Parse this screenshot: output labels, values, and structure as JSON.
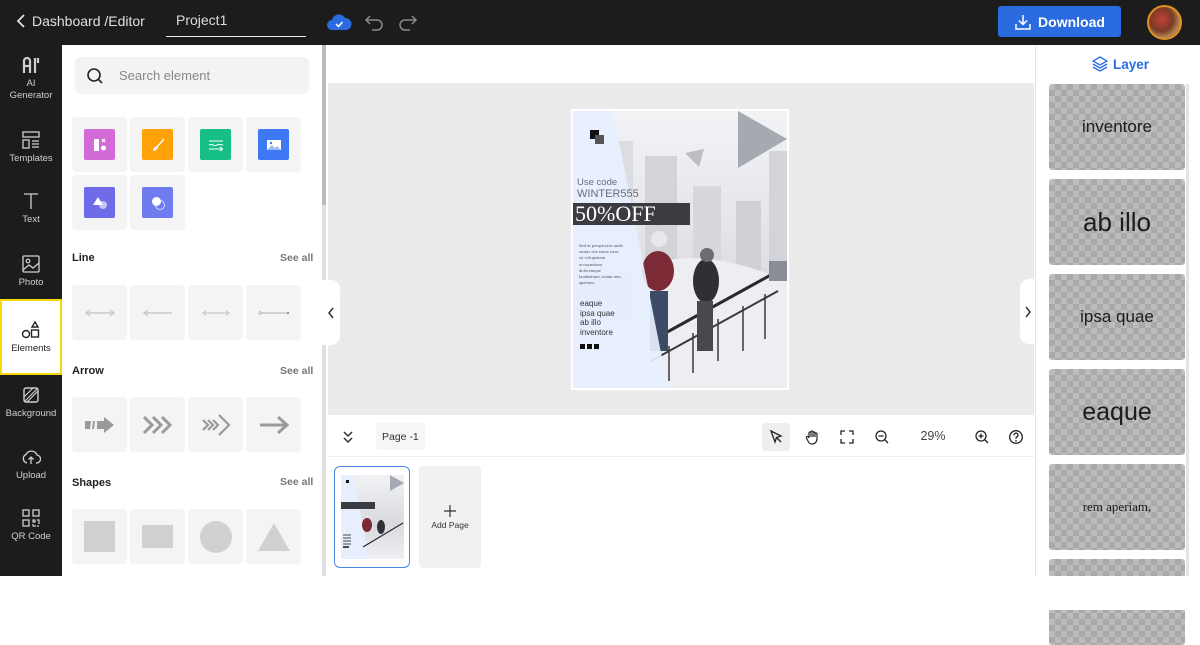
{
  "topbar": {
    "back_label": "Dashboard /Editor",
    "project_name": "Project1",
    "download_label": "Download",
    "icons": [
      "cloud-saved-icon",
      "undo-icon",
      "redo-icon",
      "download-icon",
      "avatar"
    ]
  },
  "rail": {
    "items": [
      {
        "label": "AI\nGenerator",
        "icon": "ai-icon"
      },
      {
        "label": "Templates",
        "icon": "templates-icon"
      },
      {
        "label": "Text",
        "icon": "text-icon"
      },
      {
        "label": "Photo",
        "icon": "photo-icon"
      },
      {
        "label": "Elements",
        "icon": "elements-icon",
        "active": true
      },
      {
        "label": "Background",
        "icon": "background-icon"
      },
      {
        "label": "Upload",
        "icon": "upload-icon"
      },
      {
        "label": "QR Code",
        "icon": "qr-code-icon"
      }
    ]
  },
  "panel": {
    "search_placeholder": "Search element",
    "categories": [
      {
        "name": "layout-icon",
        "color": "#d26ad8"
      },
      {
        "name": "brush-icon",
        "color": "#ffa20a"
      },
      {
        "name": "lines-icon",
        "color": "#16bf86"
      },
      {
        "name": "image-icon",
        "color": "#3e78f5"
      },
      {
        "name": "shapes-icon",
        "color": "#6e6ae8"
      },
      {
        "name": "circles-icon",
        "color": "#6e7cf0"
      }
    ],
    "sections": [
      {
        "title": "Line",
        "see_all": "See all"
      },
      {
        "title": "Arrow",
        "see_all": "See all"
      },
      {
        "title": "Shapes",
        "see_all": "See all"
      }
    ]
  },
  "poster": {
    "use_code": "Use code",
    "code": "WINTER555",
    "offer": "50%OFF",
    "body": "Sed ut perspiciatis unde omnis iste natus error sit voluptatem accusantium doloremque laudantium, totam rem aperiam,",
    "list": [
      "eaque",
      "ipsa quae",
      "ab illo",
      "inventore"
    ]
  },
  "pagebar": {
    "page_label": "Page -1",
    "zoom": "29%"
  },
  "pages": {
    "add_page_label": "Add Page"
  },
  "layers": {
    "title": "Layer",
    "items": [
      "inventore",
      "ab illo",
      "ipsa quae",
      "eaque",
      "rem aperiam,",
      ""
    ]
  }
}
